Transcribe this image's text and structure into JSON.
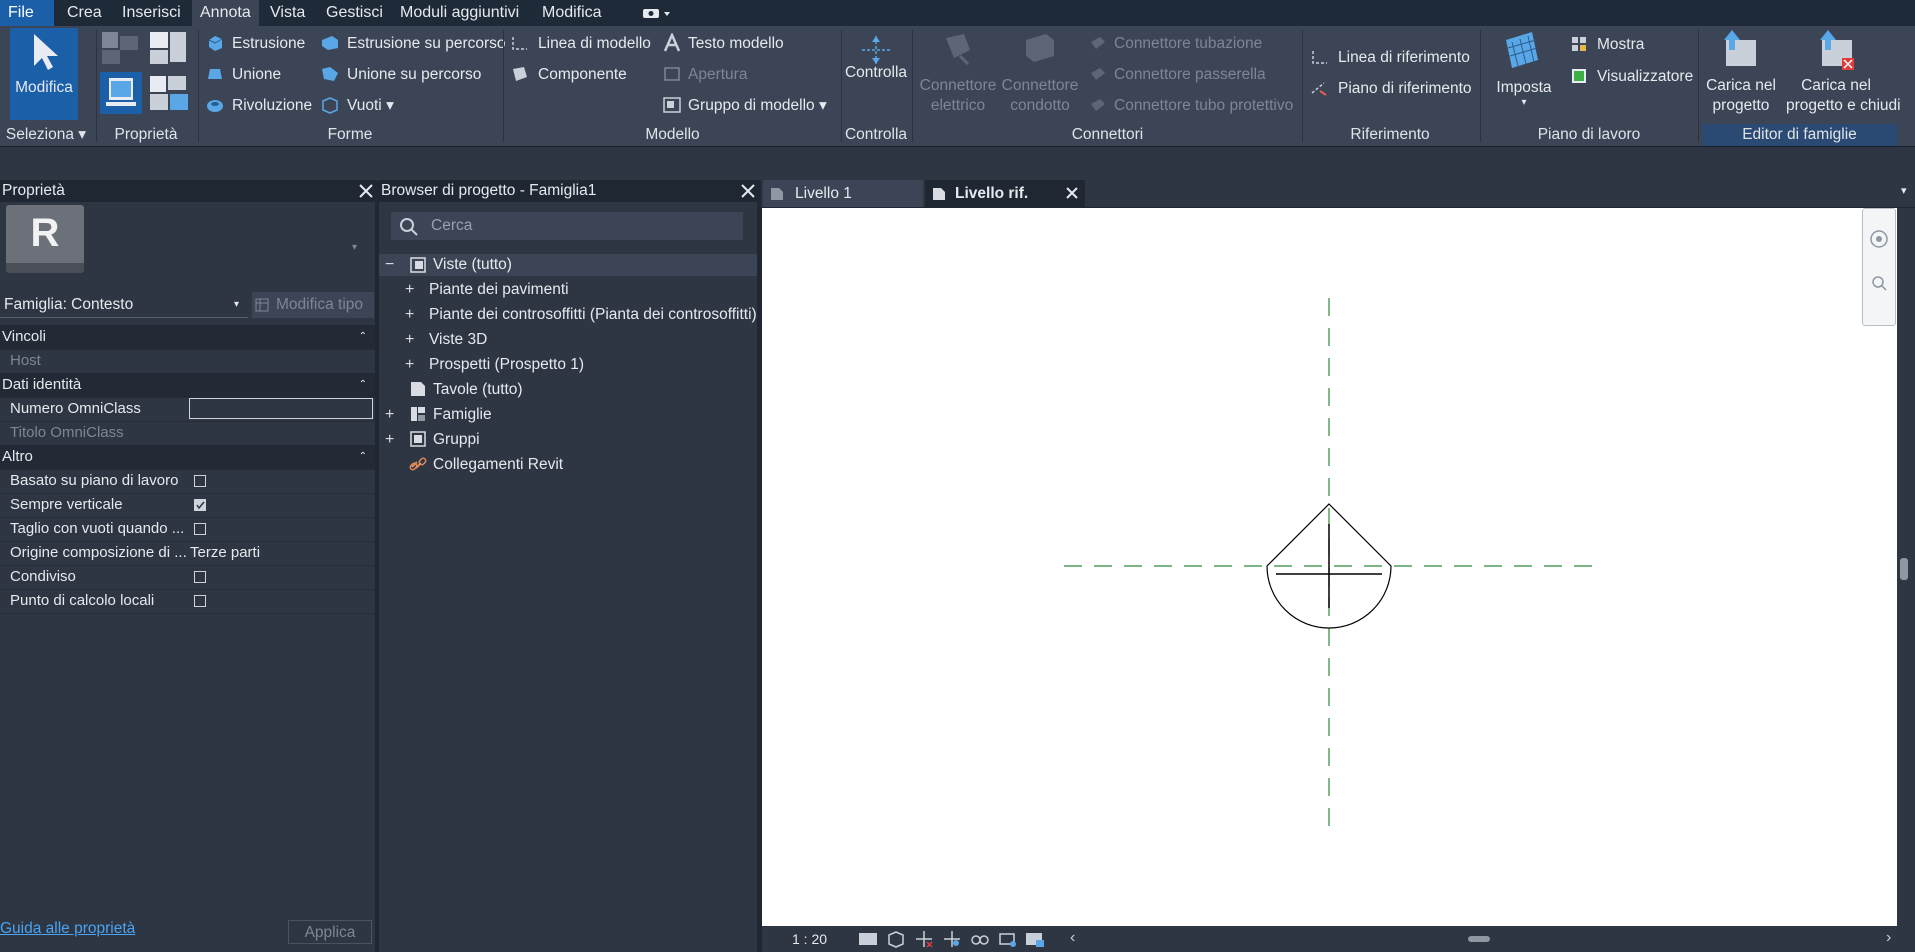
{
  "menu": {
    "items": [
      "File",
      "Crea",
      "Inserisci",
      "Annota",
      "Vista",
      "Gestisci",
      "Moduli aggiuntivi",
      "Modifica"
    ],
    "active": "Annota"
  },
  "ribbon": {
    "select": {
      "button": "Modifica",
      "panel": "Seleziona"
    },
    "properties_panel": "Proprietà",
    "forms": {
      "panel": "Forme",
      "items": [
        "Estrusione",
        "Unione",
        "Rivoluzione",
        "Estrusione su percorso",
        "Unione su percorso",
        "Vuoti"
      ]
    },
    "model": {
      "panel": "Modello",
      "items": [
        "Linea di modello",
        "Componente",
        "Testo modello",
        "Apertura",
        "Gruppo di modello"
      ]
    },
    "control": {
      "button": "Controlla",
      "panel": "Controlla"
    },
    "connectors": {
      "panel": "Connettori",
      "electric": [
        "Connettore",
        "elettrico"
      ],
      "duct": [
        "Connettore",
        "condotto"
      ],
      "items": [
        "Connettore tubazione",
        "Connettore passerella",
        "Connettore tubo protettivo"
      ]
    },
    "reference": {
      "panel": "Riferimento",
      "items": [
        "Linea di riferimento",
        "Piano di riferimento"
      ]
    },
    "workplane": {
      "panel": "Piano di lavoro",
      "set": "Imposta",
      "items": [
        "Mostra",
        "Visualizzatore"
      ]
    },
    "family_editor": {
      "panel": "Editor di famiglie",
      "load": [
        "Carica nel",
        "progetto"
      ],
      "load_close": [
        "Carica nel",
        "progetto e chiudi"
      ]
    }
  },
  "properties": {
    "title": "Proprietà",
    "logo_letter": "R",
    "type_selector": "Famiglia: Contesto",
    "edit_type": "Modifica tipo",
    "groups": {
      "constraints": "Vincoli",
      "identity": "Dati identità",
      "other": "Altro"
    },
    "rows": {
      "host": "Host",
      "omniclass_number": "Numero OmniClass",
      "omniclass_title": "Titolo OmniClass",
      "workplane_based": "Basato su piano di lavoro",
      "always_vertical": "Sempre verticale",
      "cut_with_voids": "Taglio con vuoti quando ...",
      "composition_origin": "Origine composizione di ...",
      "composition_origin_value": "Terze parti",
      "shared": "Condiviso",
      "local_calc_point": "Punto di calcolo locali"
    },
    "help_link": "Guida alle proprietà",
    "apply": "Applica"
  },
  "browser": {
    "title": "Browser di progetto - Famiglia1",
    "search_placeholder": "Cerca",
    "tree": {
      "views_all": "Viste (tutto)",
      "floor_plans": "Piante dei pavimenti",
      "ceiling_plans": "Piante dei controsoffitti (Pianta dei controsoffitti)",
      "views_3d": "Viste 3D",
      "elevations": "Prospetti (Prospetto 1)",
      "sheets": "Tavole (tutto)",
      "families": "Famiglie",
      "groups": "Gruppi",
      "revit_links": "Collegamenti Revit"
    }
  },
  "view_tabs": [
    "Livello 1",
    "Livello rif."
  ],
  "status": {
    "scale": "1 : 20"
  },
  "colors": {
    "accent": "#1b5fa8",
    "ribbon": "#3b4556",
    "panel": "#2e3644",
    "refplane": "#2d8a3a"
  }
}
